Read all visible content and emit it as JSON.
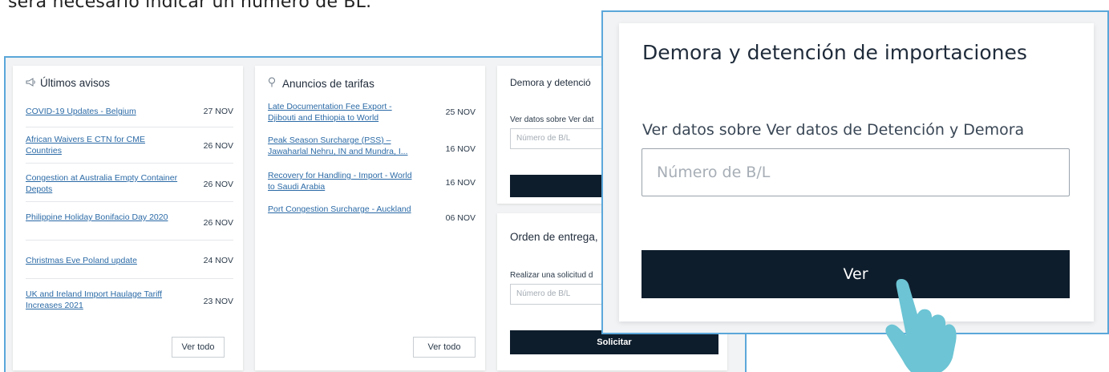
{
  "intro_text": "será necesario indicar un número de BL.",
  "avisos": {
    "title": "Últimos avisos",
    "icon": "megaphone-icon",
    "items": [
      {
        "label": "COVID-19 Updates - Belgium",
        "date": "27 NOV"
      },
      {
        "label": "African Waivers E CTN for CME Countries",
        "date": "26 NOV"
      },
      {
        "label": "Congestion at Australia Empty Container Depots",
        "date": "26 NOV"
      },
      {
        "label": "Philippine Holiday Bonifacio Day 2020",
        "date": "26 NOV"
      },
      {
        "label": "Christmas Eve Poland update",
        "date": "24 NOV"
      },
      {
        "label": "UK and Ireland Import Haulage Tariff Increases 2021",
        "date": "23 NOV"
      }
    ],
    "see_all": "Ver todo"
  },
  "tarifas": {
    "title": "Anuncios de tarifas",
    "icon": "pin-icon",
    "items": [
      {
        "label": "Late Documentation Fee Export - Djibouti and Ethiopia to World",
        "date": "25 NOV"
      },
      {
        "label": "Peak Season Surcharge (PSS) – Jawaharlal Nehru, IN and Mundra, I...",
        "date": "16 NOV"
      },
      {
        "label": "Recovery for Handling - Import - World to Saudi Arabia",
        "date": "16 NOV"
      },
      {
        "label": "Port Congestion Surcharge - Auckland",
        "date": "06 NOV"
      }
    ],
    "see_all": "Ver todo"
  },
  "demora_card": {
    "title": "Demora y detenció",
    "label": "Ver datos sobre Ver dat",
    "placeholder": "Número de B/L"
  },
  "orden_card": {
    "title": "Orden de entrega, a",
    "label": "Realizar una solicitud d",
    "placeholder": "Número de B/L",
    "button": "Solicitar"
  },
  "zoom": {
    "title": "Demora y detención de importaciones",
    "label": "Ver datos sobre Ver datos de Detención y Demora",
    "placeholder": "Número de B/L",
    "button": "Ver"
  },
  "colors": {
    "accent_border": "#5ba7da",
    "dark_button": "#0e1d2c",
    "link": "#2b6aa6",
    "hand": "#6cc4d4"
  }
}
